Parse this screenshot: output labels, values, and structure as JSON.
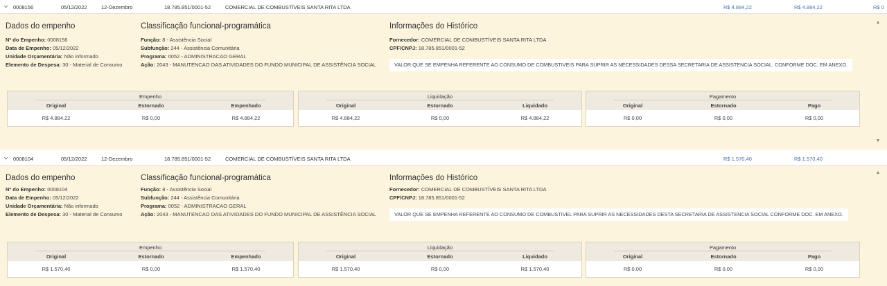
{
  "rows": [
    {
      "number": "0008156",
      "date": "05/12/2022",
      "month": "12-Dezembro",
      "cnpj": "18.785.851/0001-52",
      "supplier": "COMERCIAL DE COMBUSTÍVEIS SANTA RITA LTDA",
      "value1": "R$ 4.884,22",
      "value2": "R$ 4.884,22",
      "value3": "R$ 0",
      "dados": {
        "title": "Dados do empenho",
        "numero_label": "Nº do Empenho:",
        "numero": "0008156",
        "data_label": "Data de Empenho:",
        "data": "05/12/2022",
        "unidade_label": "Unidade Orçamentária:",
        "unidade": "Não informado",
        "elemento_label": "Elemento de Despesa:",
        "elemento": "30 - Material de Consumo"
      },
      "classificacao": {
        "title": "Classificação funcional-programática",
        "funcao_label": "Função:",
        "funcao": "8 - Assistência Social",
        "subfuncao_label": "Subfunção:",
        "subfuncao": "244 - Assistência Comunitária",
        "programa_label": "Programa:",
        "programa": "0052 - ADMINISTRACAO GERAL",
        "acao_label": "Ação:",
        "acao": "2043 - MANUTENCAO DAS ATIVIDADES DO FUNDO MUNICIPAL DE ASSISTÊNCIA SOCIAL"
      },
      "historico": {
        "title": "Informações do Histórico",
        "fornecedor_label": "Fornecedor:",
        "fornecedor": "COMERCIAL DE COMBUSTÍVEIS SANTA RITA LTDA",
        "cpf_label": "CPF/CNPJ:",
        "cpf": "18.785.851/0001-52",
        "text": "VALOR QUE SE EMPENHA REFERENTE AO CONSUMO DE COMBUSTIVEIS PARA SUPRIR AS NECESSIDADES DESSA SECRETARIA DE ASSISTENCIA SOCIAL. CONFORME DOC. EM ANEXO."
      },
      "empenho": {
        "title": "Empenho",
        "cols": [
          "Original",
          "Estornado",
          "Empenhado"
        ],
        "vals": [
          "R$ 4.884,22",
          "R$ 0,00",
          "R$ 4.884,22"
        ]
      },
      "liquidacao": {
        "title": "Liquidação",
        "cols": [
          "Original",
          "Estornado",
          "Liquidado"
        ],
        "vals": [
          "R$ 4.884,22",
          "R$ 0,00",
          "R$ 4.884,22"
        ]
      },
      "pagamento": {
        "title": "Pagamento",
        "cols": [
          "Original",
          "Estornado",
          "Pago"
        ],
        "vals": [
          "R$ 0,00",
          "R$ 0,00",
          "R$ 0,00"
        ]
      }
    },
    {
      "number": "0008104",
      "date": "05/12/2022",
      "month": "12-Dezembro",
      "cnpj": "18.785.851/0001-52",
      "supplier": "COMERCIAL DE COMBUSTÍVEIS SANTA RITA LTDA",
      "value1": "R$ 1.570,40",
      "value2": "R$ 1.570,40",
      "value3": "",
      "dados": {
        "title": "Dados do empenho",
        "numero_label": "Nº do Empenho:",
        "numero": "0008104",
        "data_label": "Data de Empenho:",
        "data": "05/12/2022",
        "unidade_label": "Unidade Orçamentária:",
        "unidade": "Não informado",
        "elemento_label": "Elemento de Despesa:",
        "elemento": "30 - Material de Consumo"
      },
      "classificacao": {
        "title": "Classificação funcional-programática",
        "funcao_label": "Função:",
        "funcao": "8 - Assistência Social",
        "subfuncao_label": "Subfunção:",
        "subfuncao": "244 - Assistência Comunitária",
        "programa_label": "Programa:",
        "programa": "0052 - ADMINISTRACAO GERAL",
        "acao_label": "Ação:",
        "acao": "2043 - MANUTENCAO DAS ATIVIDADES DO FUNDO MUNICIPAL DE ASSISTÊNCIA SOCIAL"
      },
      "historico": {
        "title": "Informações do Histórico",
        "fornecedor_label": "Fornecedor:",
        "fornecedor": "COMERCIAL DE COMBUSTÍVEIS SANTA RITA LTDA",
        "cpf_label": "CPF/CNPJ:",
        "cpf": "18.785.851/0001-52",
        "text": "VALOR QUE SE EMPENHA REFERENTE AO CONSUMO DE COMBUSTIVEL PARA SUPRIR AS NECESSIDADES DESTA SECRETARIA DE ASSISTENCIA SOCIAL CONFORME DOC. EM ANEXO."
      },
      "empenho": {
        "title": "Empenho",
        "cols": [
          "Original",
          "Estornado",
          "Empenhado"
        ],
        "vals": [
          "R$ 1.570,40",
          "R$ 0,00",
          "R$ 1.570,40"
        ]
      },
      "liquidacao": {
        "title": "Liquidação",
        "cols": [
          "Original",
          "Estornado",
          "Liquidado"
        ],
        "vals": [
          "R$ 1.570,40",
          "R$ 0,00",
          "R$ 1.570,40"
        ]
      },
      "pagamento": {
        "title": "Pagamento",
        "cols": [
          "Original",
          "Estornado",
          "Pago"
        ],
        "vals": [
          "R$ 0,00",
          "R$ 0,00",
          "R$ 0,00"
        ]
      }
    }
  ]
}
